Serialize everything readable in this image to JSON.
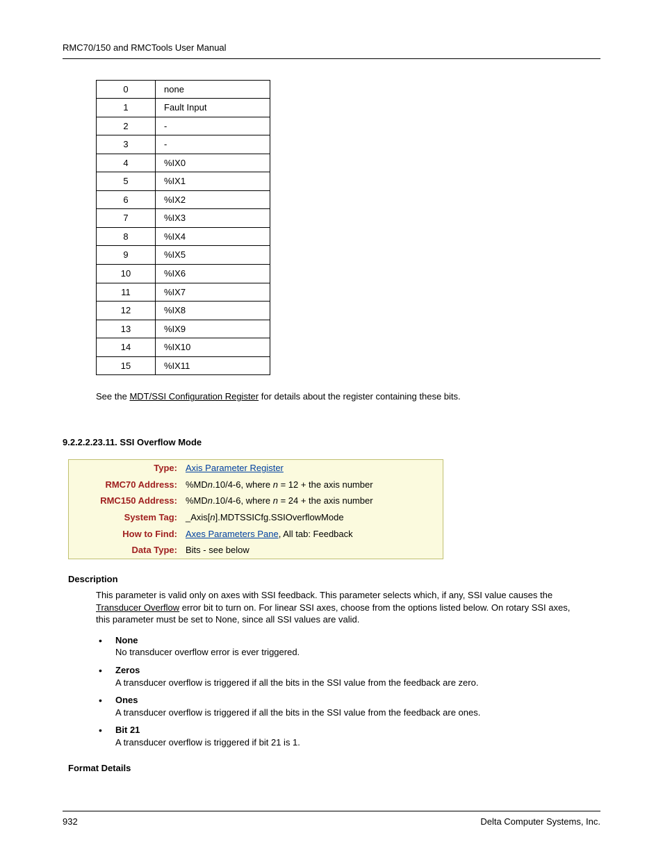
{
  "header": "RMC70/150 and RMCTools User Manual",
  "table": [
    {
      "num": "0",
      "val": "none"
    },
    {
      "num": "1",
      "val": "Fault Input"
    },
    {
      "num": "2",
      "val": "-"
    },
    {
      "num": "3",
      "val": "-"
    },
    {
      "num": "4",
      "val": "%IX0"
    },
    {
      "num": "5",
      "val": "%IX1"
    },
    {
      "num": "6",
      "val": "%IX2"
    },
    {
      "num": "7",
      "val": "%IX3"
    },
    {
      "num": "8",
      "val": "%IX4"
    },
    {
      "num": "9",
      "val": "%IX5"
    },
    {
      "num": "10",
      "val": "%IX6"
    },
    {
      "num": "11",
      "val": "%IX7"
    },
    {
      "num": "12",
      "val": "%IX8"
    },
    {
      "num": "13",
      "val": "%IX9"
    },
    {
      "num": "14",
      "val": "%IX10"
    },
    {
      "num": "15",
      "val": "%IX11"
    }
  ],
  "see_pre": "See the ",
  "see_link": "MDT/SSI Configuration Register",
  "see_post": " for details about the register containing these bits.",
  "section_number": "9.2.2.2.23.11. SSI Overflow Mode",
  "info": {
    "type_label": "Type:",
    "type_value": "Axis Parameter Register",
    "rmc70_label": "RMC70 Address:",
    "rmc70_pre": "%MD",
    "rmc70_n": "n",
    "rmc70_mid": ".10/4-6, where ",
    "rmc70_n2": "n",
    "rmc70_post": " = 12 + the axis number",
    "rmc150_label": "RMC150 Address:",
    "rmc150_pre": "%MD",
    "rmc150_n": "n",
    "rmc150_mid": ".10/4-6, where ",
    "rmc150_n2": "n",
    "rmc150_post": " = 24 + the axis number",
    "tag_label": "System Tag:",
    "tag_pre": "_Axis[",
    "tag_n": "n",
    "tag_post": "].MDTSSICfg.SSIOverflowMode",
    "how_label": "How to Find:",
    "how_link": "Axes Parameters Pane",
    "how_post": ", All tab: Feedback",
    "dtype_label": "Data Type:",
    "dtype_value": "Bits - see below"
  },
  "desc_head": "Description",
  "desc_pre": "This parameter is valid only on axes with SSI feedback. This parameter selects which, if any, SSI value causes the ",
  "desc_link": "Transducer Overflow",
  "desc_post": " error bit to turn on. For linear SSI axes, choose from the options listed below. On rotary SSI axes, this parameter must be set to None, since all SSI values are valid.",
  "opts": [
    {
      "title": "None",
      "body": "No transducer overflow error is ever triggered."
    },
    {
      "title": "Zeros",
      "body": "A transducer overflow is triggered if all the bits in the SSI value from the feedback are zero."
    },
    {
      "title": "Ones",
      "body": "A transducer overflow is triggered if all the bits in the SSI value from the feedback are ones."
    },
    {
      "title": "Bit 21",
      "body": "A transducer overflow is triggered if bit 21 is 1."
    }
  ],
  "format_head": "Format Details",
  "footer": {
    "page": "932",
    "company": "Delta Computer Systems, Inc."
  }
}
